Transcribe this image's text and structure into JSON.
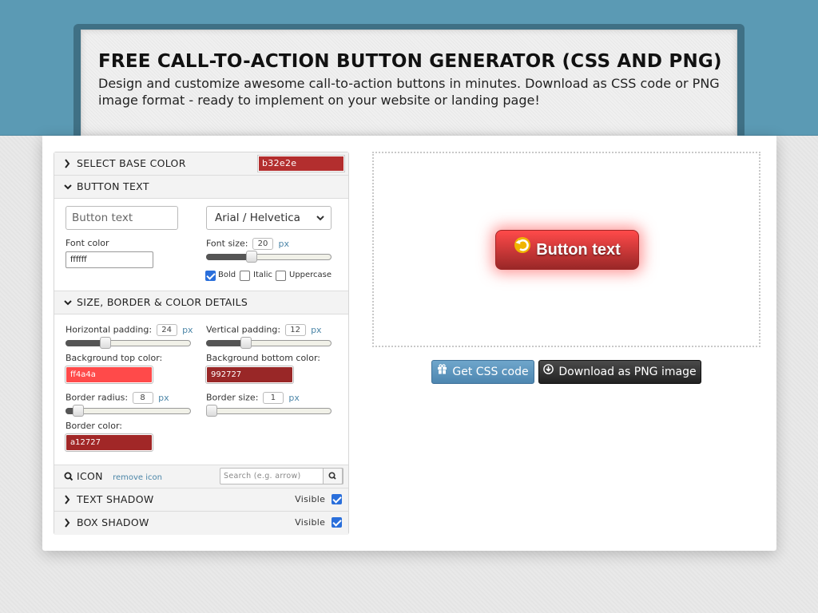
{
  "header": {
    "title": "FREE CALL-TO-ACTION BUTTON GENERATOR (CSS AND PNG)",
    "subtitle": "Design and customize awesome call-to-action buttons in minutes. Download as CSS code or PNG image format - ready to implement on your website or landing page!"
  },
  "colors": {
    "base": "#b32e2e",
    "bg_top": "#ff4a4a",
    "bg_bottom": "#992727",
    "border": "#a12727",
    "font": "#ffffff",
    "header_band": "#5b9ab4"
  },
  "base_color": {
    "label": "SELECT BASE COLOR",
    "value": "b32e2e"
  },
  "button_text": {
    "label": "BUTTON TEXT",
    "text_placeholder": "Button text",
    "font_family": "Arial / Helvetica",
    "font_color_label": "Font color",
    "font_color_value": "ffffff",
    "font_size_label": "Font size:",
    "font_size_value": "20",
    "font_size_unit": "px",
    "font_size_level": 0.35,
    "bold_label": "Bold",
    "bold_checked": true,
    "italic_label": "Italic",
    "italic_checked": false,
    "uppercase_label": "Uppercase",
    "uppercase_checked": false
  },
  "details": {
    "label": "SIZE, BORDER & COLOR DETAILS",
    "h_padding_label": "Horizontal padding:",
    "h_padding_value": "24",
    "h_padding_level": 0.3,
    "v_padding_label": "Vertical padding:",
    "v_padding_value": "12",
    "v_padding_level": 0.3,
    "unit": "px",
    "bg_top_label": "Background top color:",
    "bg_top_value": "ff4a4a",
    "bg_bottom_label": "Background bottom color:",
    "bg_bottom_value": "992727",
    "radius_label": "Border radius:",
    "radius_value": "8",
    "radius_level": 0.06,
    "border_size_label": "Border size:",
    "border_size_value": "1",
    "border_size_level": 0.0,
    "border_color_label": "Border color:",
    "border_color_value": "a12727"
  },
  "icon_section": {
    "label": "ICON",
    "remove_label": "remove icon",
    "search_placeholder": "Search (e.g. arrow)"
  },
  "text_shadow": {
    "label": "TEXT SHADOW",
    "visible_label": "Visible",
    "visible_checked": true
  },
  "box_shadow": {
    "label": "BOX SHADOW",
    "visible_label": "Visible",
    "visible_checked": true
  },
  "preview": {
    "button_label": "Button text",
    "icon": "undo-circle-arrow-icon"
  },
  "actions": {
    "css_label": "Get CSS code",
    "css_icon": "gift-icon",
    "png_label": "Download as PNG image",
    "png_icon": "download-circle-icon"
  }
}
